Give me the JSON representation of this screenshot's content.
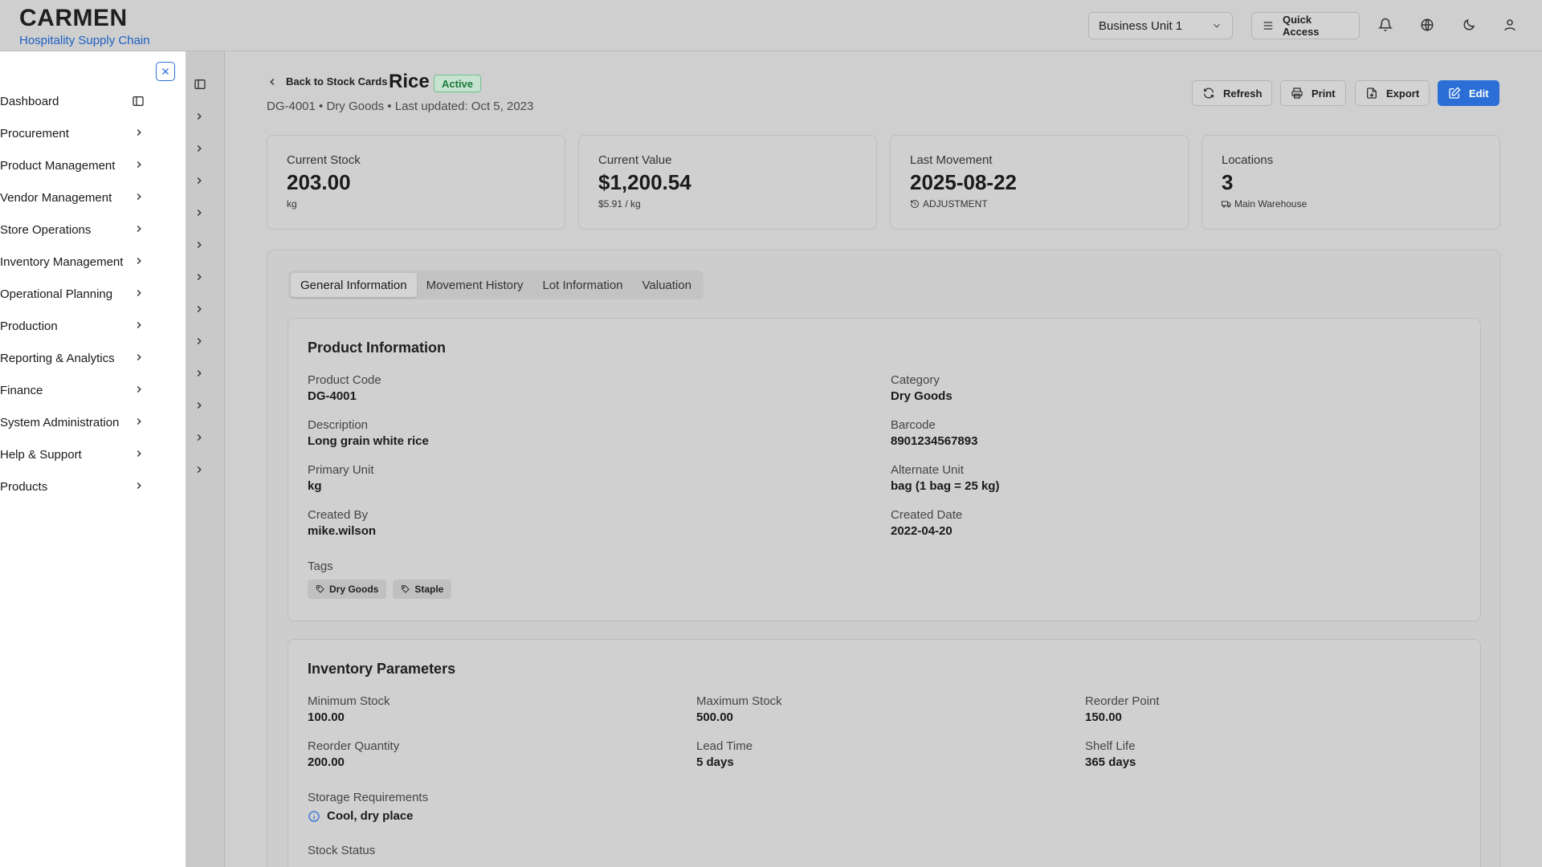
{
  "brand": {
    "title": "CARMEN",
    "subtitle": "Hospitality Supply Chain"
  },
  "header": {
    "business_unit": "Business Unit 1",
    "quick_access": "Quick Access"
  },
  "sidebar": {
    "items": [
      {
        "label": "Dashboard"
      },
      {
        "label": "Procurement"
      },
      {
        "label": "Product Management"
      },
      {
        "label": "Vendor Management"
      },
      {
        "label": "Store Operations"
      },
      {
        "label": "Inventory Management"
      },
      {
        "label": "Operational Planning"
      },
      {
        "label": "Production"
      },
      {
        "label": "Reporting & Analytics"
      },
      {
        "label": "Finance"
      },
      {
        "label": "System Administration"
      },
      {
        "label": "Help & Support"
      },
      {
        "label": "Products"
      }
    ]
  },
  "page": {
    "back_label": "Back to Stock Cards",
    "title": "Rice",
    "status": "Active",
    "subtitle": "DG-4001 • Dry Goods • Last updated: Oct 5, 2023",
    "actions": {
      "refresh": "Refresh",
      "print": "Print",
      "export": "Export",
      "edit": "Edit"
    }
  },
  "stats": [
    {
      "label": "Current Stock",
      "value": "203.00",
      "sub": "kg"
    },
    {
      "label": "Current Value",
      "value": "$1,200.54",
      "sub": "$5.91 / kg"
    },
    {
      "label": "Last Movement",
      "value": "2025-08-22",
      "sub": "ADJUSTMENT"
    },
    {
      "label": "Locations",
      "value": "3",
      "sub": "Main Warehouse"
    }
  ],
  "tabs": [
    {
      "label": "General Information"
    },
    {
      "label": "Movement History"
    },
    {
      "label": "Lot Information"
    },
    {
      "label": "Valuation"
    }
  ],
  "product_info": {
    "title": "Product Information",
    "product_code_label": "Product Code",
    "product_code": "DG-4001",
    "category_label": "Category",
    "category": "Dry Goods",
    "description_label": "Description",
    "description": "Long grain white rice",
    "barcode_label": "Barcode",
    "barcode": "8901234567893",
    "primary_unit_label": "Primary Unit",
    "primary_unit": "kg",
    "alternate_unit_label": "Alternate Unit",
    "alternate_unit": "bag (1 bag = 25 kg)",
    "created_by_label": "Created By",
    "created_by": "mike.wilson",
    "created_date_label": "Created Date",
    "created_date": "2022-04-20",
    "tags_label": "Tags",
    "tags": [
      "Dry Goods",
      "Staple"
    ]
  },
  "inventory_params": {
    "title": "Inventory Parameters",
    "min_stock_label": "Minimum Stock",
    "min_stock": "100.00",
    "max_stock_label": "Maximum Stock",
    "max_stock": "500.00",
    "reorder_point_label": "Reorder Point",
    "reorder_point": "150.00",
    "reorder_qty_label": "Reorder Quantity",
    "reorder_qty": "200.00",
    "lead_time_label": "Lead Time",
    "lead_time": "5 days",
    "shelf_life_label": "Shelf Life",
    "shelf_life": "365 days",
    "storage_label": "Storage Requirements",
    "storage": "Cool, dry place",
    "stock_status_label": "Stock Status"
  },
  "colors": {
    "accent": "#2b6fd6",
    "active_badge": "#1a7a3a"
  }
}
